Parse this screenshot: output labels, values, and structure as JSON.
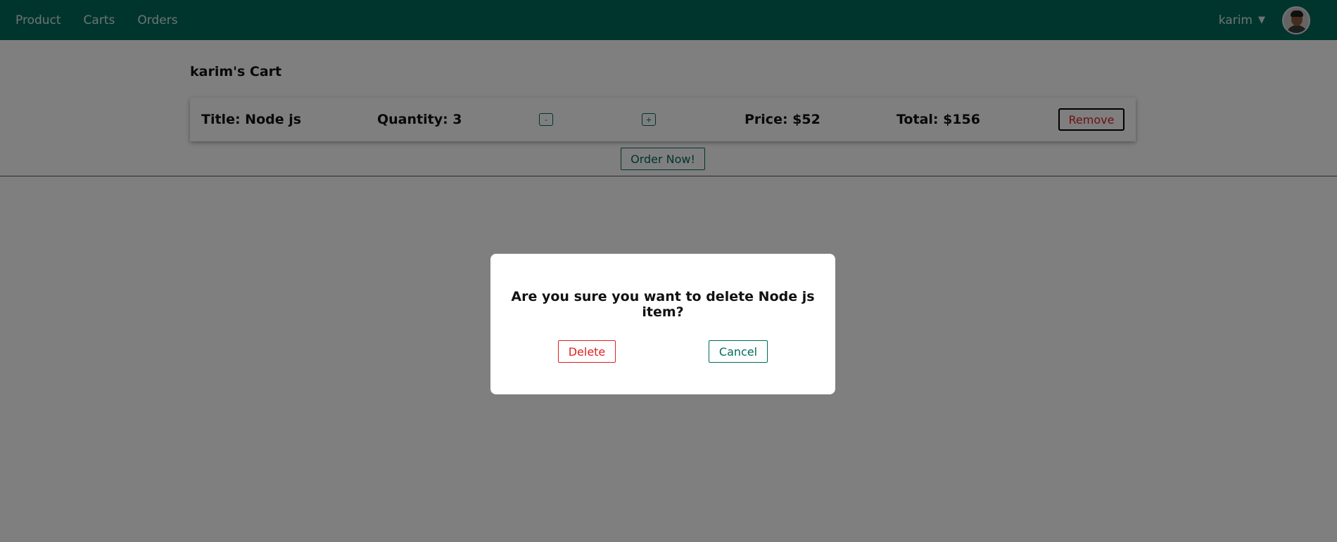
{
  "nav": {
    "links": [
      "Product",
      "Carts",
      "Orders"
    ],
    "user": "karim",
    "caret_icon": "caret-down-icon",
    "bg_color": "#006b5b"
  },
  "cart": {
    "title": "karim's Cart",
    "item": {
      "title_text": "Title: Node js",
      "quantity_text": "Quantity: 3",
      "minus_label": "-",
      "plus_label": "+",
      "price_text": "Price: $52",
      "total_text": "Total: $156",
      "remove_label": "Remove"
    },
    "order_label": "Order Now!"
  },
  "modal": {
    "message": "Are you sure you want to delete Node js item?",
    "delete_label": "Delete",
    "cancel_label": "Cancel"
  },
  "colors": {
    "accent": "#006b5b",
    "danger": "#e01f1f",
    "overlay": "rgba(0,0,0,0.5)"
  }
}
